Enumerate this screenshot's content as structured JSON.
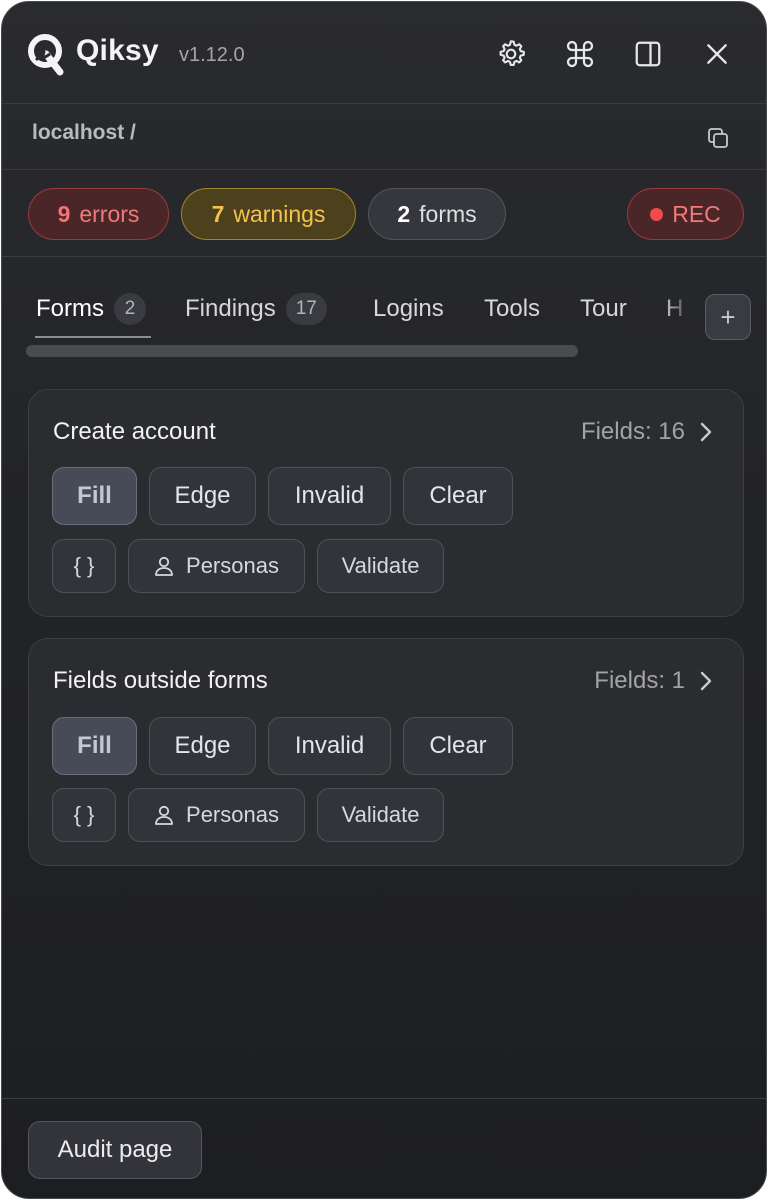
{
  "app": {
    "name": "Qiksy",
    "version": "v1.12.0"
  },
  "header_icons": [
    "gear-icon",
    "command-icon",
    "sidebar-panel-icon",
    "close-icon"
  ],
  "url": {
    "text": "localhost /"
  },
  "stats": {
    "errors": {
      "count": "9",
      "label": "errors"
    },
    "warnings": {
      "count": "7",
      "label": "warnings"
    },
    "forms": {
      "count": "2",
      "label": "forms"
    },
    "rec": {
      "label": "REC"
    }
  },
  "tabs": [
    {
      "label": "Forms",
      "count": "2"
    },
    {
      "label": "Findings",
      "count": "17"
    },
    {
      "label": "Logins"
    },
    {
      "label": "Tools"
    },
    {
      "label": "Tour"
    },
    {
      "label": "H"
    }
  ],
  "add_tab_label": "+",
  "cards": [
    {
      "title": "Create account",
      "fields": "Fields: 16",
      "actions": [
        "Fill",
        "Edge",
        "Invalid",
        "Clear"
      ],
      "json_label": "{ }",
      "personas_label": "Personas",
      "validate_label": "Validate"
    },
    {
      "title": "Fields outside forms",
      "fields": "Fields: 1",
      "actions": [
        "Fill",
        "Edge",
        "Invalid",
        "Clear"
      ],
      "json_label": "{ }",
      "personas_label": "Personas",
      "validate_label": "Validate"
    }
  ],
  "footer": {
    "audit_label": "Audit page"
  },
  "colors": {
    "error": "#f57373",
    "warning": "#f3c44c",
    "background": "#26272a"
  }
}
